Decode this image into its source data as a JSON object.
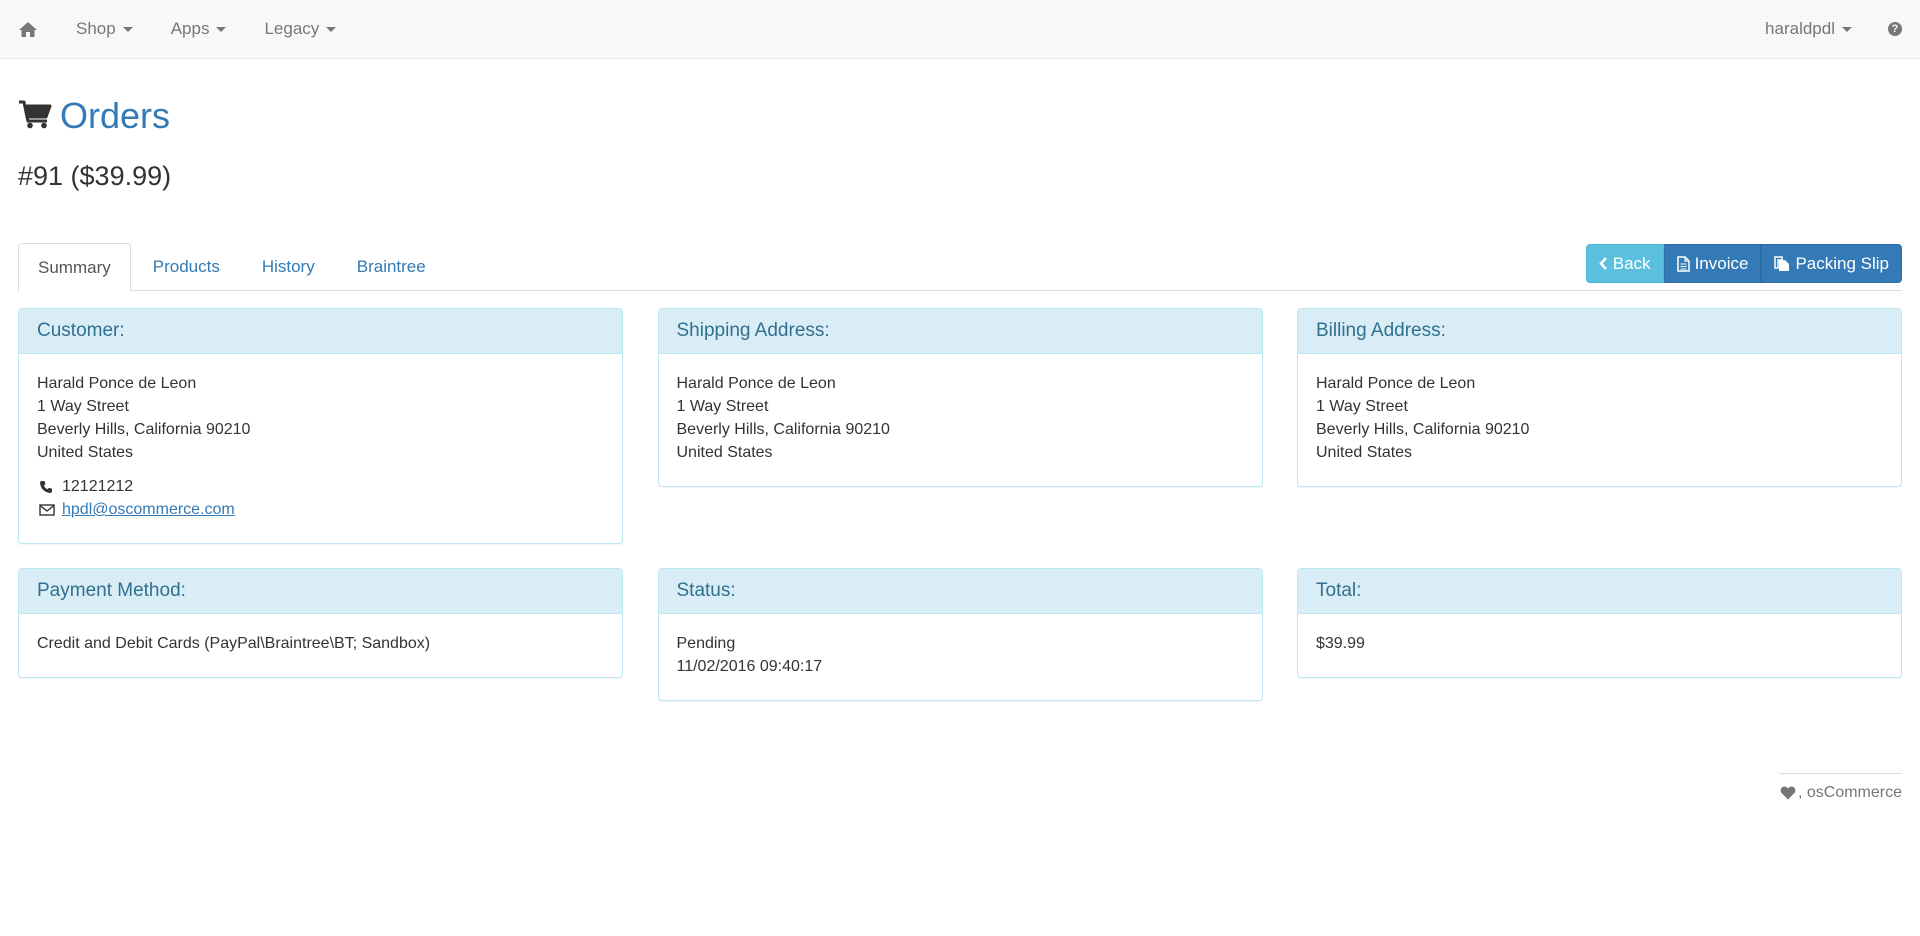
{
  "navbar": {
    "home_icon": "home-icon",
    "menus": [
      {
        "label": "Shop"
      },
      {
        "label": "Apps"
      },
      {
        "label": "Legacy"
      }
    ],
    "user": "haraldpdl",
    "help_icon": "question-circle-icon"
  },
  "page": {
    "title": "Orders",
    "title_icon": "shopping-cart-icon",
    "order_heading": "#91 ($39.99)"
  },
  "buttons": {
    "back": "Back",
    "invoice": "Invoice",
    "packing_slip": "Packing Slip"
  },
  "tabs": [
    {
      "label": "Summary",
      "active": true
    },
    {
      "label": "Products"
    },
    {
      "label": "History"
    },
    {
      "label": "Braintree"
    }
  ],
  "panels": {
    "customer": {
      "heading": "Customer:",
      "lines": [
        "Harald Ponce de Leon",
        "1 Way Street",
        "Beverly Hills, California 90210",
        "United States"
      ],
      "phone": "12121212",
      "email": "hpdl@oscommerce.com"
    },
    "shipping": {
      "heading": "Shipping Address:",
      "lines": [
        "Harald Ponce de Leon",
        "1 Way Street",
        "Beverly Hills, California 90210",
        "United States"
      ]
    },
    "billing": {
      "heading": "Billing Address:",
      "lines": [
        "Harald Ponce de Leon",
        "1 Way Street",
        "Beverly Hills, California 90210",
        "United States"
      ]
    },
    "payment": {
      "heading": "Payment Method:",
      "value": "Credit and Debit Cards (PayPal\\Braintree\\BT; Sandbox)"
    },
    "status": {
      "heading": "Status:",
      "value": "Pending",
      "date": "11/02/2016 09:40:17"
    },
    "total": {
      "heading": "Total:",
      "value": "$39.99"
    }
  },
  "footer": {
    "text": ", osCommerce",
    "icon": "heart-icon"
  },
  "colors": {
    "link": "#337ab7",
    "info_button": "#5bc0de",
    "primary_button": "#337ab7",
    "panel_heading_bg": "#d9edf7",
    "panel_heading_text": "#31708f"
  }
}
